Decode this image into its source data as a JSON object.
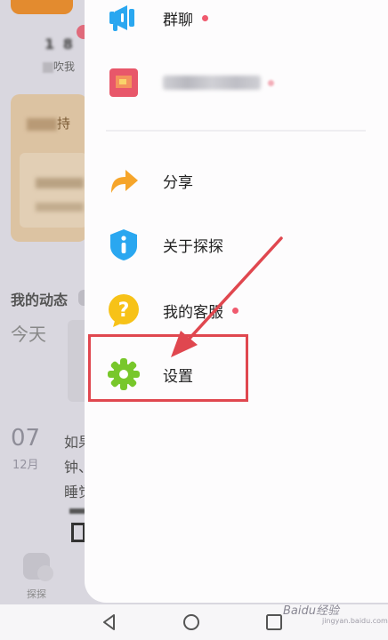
{
  "background": {
    "like_text": "吹我",
    "section_title": "我的动态",
    "today": "今天",
    "date_day": "07",
    "date_month": "12月",
    "post_lines": [
      "如果",
      "钟、",
      "睡觉"
    ],
    "bottom_tab": "探探",
    "card_title_tail": "持"
  },
  "drawer": {
    "items": [
      {
        "label": "群聊",
        "icon": "megaphone-icon",
        "badge": true
      },
      {
        "label": "",
        "icon": "avatar-icon",
        "badge": true
      },
      {
        "label": "分享",
        "icon": "share-arrow-icon",
        "badge": false
      },
      {
        "label": "关于探探",
        "icon": "info-icon",
        "badge": false
      },
      {
        "label": "我的客服",
        "icon": "question-icon",
        "badge": true
      },
      {
        "label": "设置",
        "icon": "gear-icon",
        "badge": false
      }
    ]
  },
  "watermark": {
    "text": "Baidu经验",
    "sub": "jingyan.baidu.com"
  },
  "colors": {
    "accent_red": "#f05a6e",
    "annotation_red": "#e0474f",
    "icon_blue": "#2aa7f0",
    "icon_orange": "#f6a52a",
    "icon_yellow": "#f7c218",
    "icon_green": "#78c72b"
  }
}
